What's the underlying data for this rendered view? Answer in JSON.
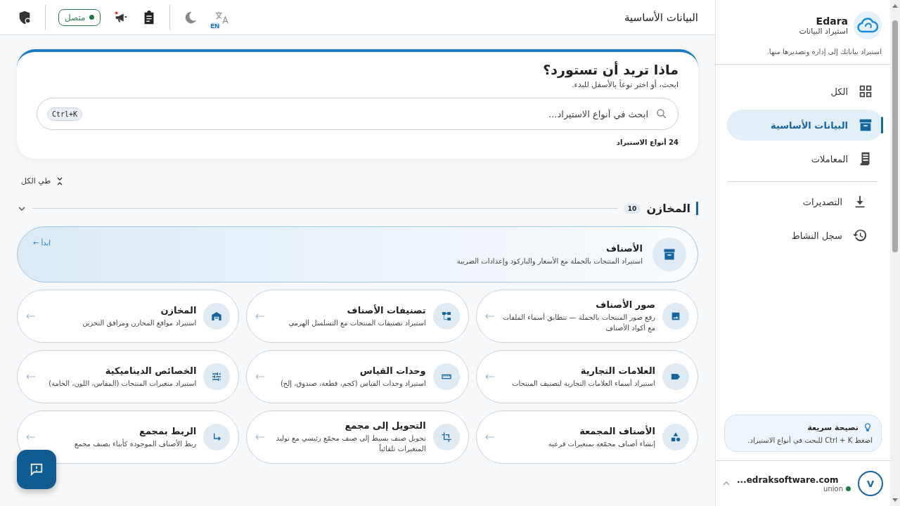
{
  "sidebar": {
    "brand": {
      "name": "Edara",
      "subtitle": "استيراد البيانات",
      "description": "استيراد بياناتك إلى إدارة وتصديرها منها."
    },
    "nav_groups": [
      [
        {
          "kind": "grid",
          "label": "الكل",
          "selected": false
        },
        {
          "kind": "archive",
          "label": "البيانات الأساسية",
          "selected": true
        },
        {
          "kind": "receipt",
          "label": "المعاملات",
          "selected": false
        }
      ],
      [
        {
          "kind": "download",
          "label": "التصديرات",
          "selected": false
        },
        {
          "kind": "history",
          "label": "سجل النشاط",
          "selected": false
        }
      ]
    ],
    "tip": {
      "title": "نصيحة سريعة",
      "text": "اضغط Ctrl + K للبحث في أنواع الاستيراد."
    },
    "user": {
      "initial": "V",
      "email": "...edraksoftware.com",
      "org": "union",
      "online": true
    }
  },
  "header": {
    "title": "البيانات الأساسية",
    "language": "EN",
    "status": {
      "label": "متصل",
      "online": true
    }
  },
  "hero": {
    "title": "ماذا تريد أن تستورد؟",
    "subtitle": "ابحث، أو اختر نوعاً بالأسفل للبدء.",
    "search": {
      "placeholder": "ابحث في أنواع الاستيراد...",
      "shortcut": "Ctrl+K"
    },
    "count": "24 أنواع الاستيراد"
  },
  "collapse_all": "طي الكل",
  "section": {
    "title": "المخازن",
    "count": "10",
    "expanded": true,
    "featured": {
      "kind": "archive",
      "title": "الأصناف",
      "description": "استيراد المنتجات بالجملة مع الأسعار والباركود وإعدادات الضريبة",
      "action": "ابدأ ←"
    },
    "cards": [
      {
        "kind": "image",
        "title": "صور الأصناف",
        "description": "رفع صور المنتجات بالجملة — تتطابق أسماء الملفات مع أكواد الأصناف"
      },
      {
        "kind": "tree",
        "title": "تصنيفات الأصناف",
        "description": "استيراد تصنيفات المنتجات مع التسلسل الهرمي"
      },
      {
        "kind": "warehouse",
        "title": "المخازن",
        "description": "استيراد مواقع المخازن ومرافق التخزين"
      },
      {
        "kind": "label",
        "title": "العلامات التجارية",
        "description": "استيراد أسماء العلامات التجارية لتصنيف المنتجات"
      },
      {
        "kind": "ruler",
        "title": "وحدات القياس",
        "description": "استيراد وحدات القياس (كجم، قطعة، صندوق، إلخ)"
      },
      {
        "kind": "tune",
        "title": "الخصائص الديناميكية",
        "description": "استيراد متغيرات المنتجات (المقاس، اللون، الخامة)"
      },
      {
        "kind": "shapes",
        "title": "الأصناف المجمعة",
        "description": "إنشاء أصناف مجمّعة بمتغيرات فرعية"
      },
      {
        "kind": "crop",
        "title": "التحويل إلى مجمع",
        "description": "تحويل صنف بسيط إلى صنف مجمّع رئيسي مع توليد المتغيرات تلقائياً"
      },
      {
        "kind": "subdir",
        "title": "الربط بمجمع",
        "description": "ربط الأصناف الموجودة كأبناء بصنف مجمع"
      }
    ]
  }
}
